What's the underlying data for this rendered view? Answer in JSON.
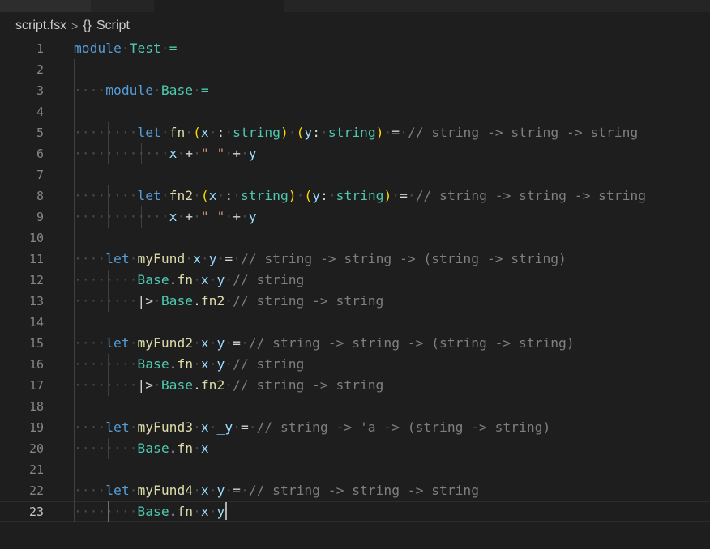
{
  "breadcrumb": {
    "file": "script.fsx",
    "separator": ">",
    "symbol_icon": "{}",
    "symbol": "Script"
  },
  "lines": [
    {
      "n": "1",
      "code": "module Test ="
    },
    {
      "n": "2",
      "code": ""
    },
    {
      "n": "3",
      "code": "    module Base ="
    },
    {
      "n": "4",
      "code": ""
    },
    {
      "n": "5",
      "code": "        let fn (x : string) (y: string) = // string -> string -> string"
    },
    {
      "n": "6",
      "code": "            x + \" \" + y"
    },
    {
      "n": "7",
      "code": ""
    },
    {
      "n": "8",
      "code": "        let fn2 (x : string) (y: string) = // string -> string -> string"
    },
    {
      "n": "9",
      "code": "            x + \" \" + y"
    },
    {
      "n": "10",
      "code": ""
    },
    {
      "n": "11",
      "code": "    let myFund x y = // string -> string -> (string -> string)"
    },
    {
      "n": "12",
      "code": "        Base.fn x y // string"
    },
    {
      "n": "13",
      "code": "        |> Base.fn2 // string -> string"
    },
    {
      "n": "14",
      "code": ""
    },
    {
      "n": "15",
      "code": "    let myFund2 x y = // string -> string -> (string -> string)"
    },
    {
      "n": "16",
      "code": "        Base.fn x y // string"
    },
    {
      "n": "17",
      "code": "        |> Base.fn2 // string -> string"
    },
    {
      "n": "18",
      "code": ""
    },
    {
      "n": "19",
      "code": "    let myFund3 x _y = // string -> 'a -> (string -> string)"
    },
    {
      "n": "20",
      "code": "        Base.fn x"
    },
    {
      "n": "21",
      "code": ""
    },
    {
      "n": "22",
      "code": "    let myFund4 x y = // string -> string -> string"
    },
    {
      "n": "23",
      "code": "        Base.fn x y"
    }
  ],
  "current_line": "23",
  "colors": {
    "keyword": "#569cd6",
    "module": "#4ec9b0",
    "identifier": "#9cdcfe",
    "string": "#ce9178",
    "comment": "#7f7f7f",
    "background": "#1e1e1e"
  }
}
